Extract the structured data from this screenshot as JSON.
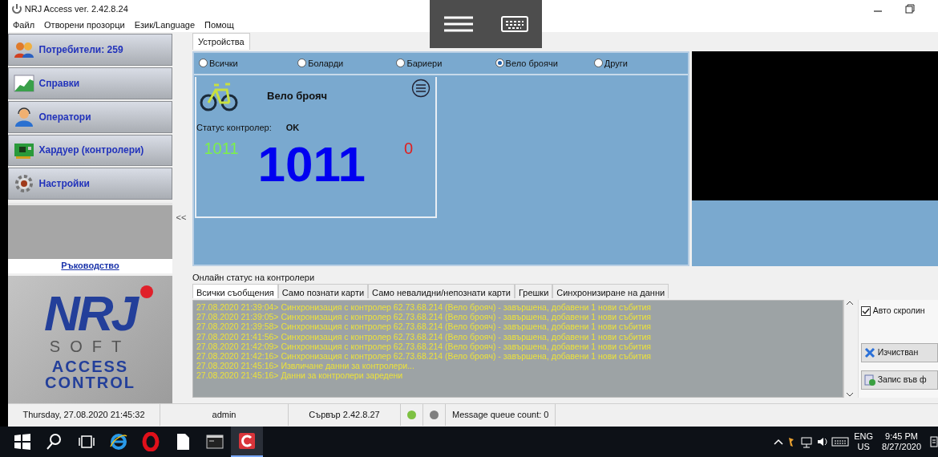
{
  "window": {
    "title": "NRJ Access ver. 2.42.8.24"
  },
  "menu": [
    "Файл",
    "Отворени прозорци",
    "Език/Language",
    "Помощ"
  ],
  "sidebar": {
    "items": [
      {
        "label": "Потребители: 259",
        "kind": "users"
      },
      {
        "label": "Справки",
        "kind": "chart"
      },
      {
        "label": "Оператори",
        "kind": "operator"
      },
      {
        "label": "Хардуер (контролери)",
        "kind": "board"
      },
      {
        "label": "Настройки",
        "kind": "gear"
      }
    ],
    "collapse": "<<",
    "manual_link": "Ръководство",
    "logo": {
      "mark": "NRJ",
      "sub": "SOFT",
      "line1": "ACCESS",
      "line2": "CONTROL"
    }
  },
  "tabs": [
    {
      "label": "Устройства",
      "selected": true
    }
  ],
  "device_filters": [
    {
      "label": "Всички",
      "selected": false
    },
    {
      "label": "Боларди",
      "selected": false
    },
    {
      "label": "Бариери",
      "selected": false
    },
    {
      "label": "Вело броячи",
      "selected": true
    },
    {
      "label": "Други",
      "selected": false
    }
  ],
  "device_card": {
    "title": "Вело брояч",
    "status_label": "Статус контролер:",
    "status_value": "OK",
    "count_in": "1011",
    "count_total": "1011",
    "count_out": "0"
  },
  "log": {
    "title": "Онлайн статус на контролери",
    "tabs": [
      {
        "label": "Всички съобщения",
        "selected": true
      },
      {
        "label": "Само познати карти",
        "selected": false
      },
      {
        "label": "Само невалидни/непознати карти",
        "selected": false
      },
      {
        "label": "Грешки",
        "selected": false
      },
      {
        "label": "Синхронизиране на данни",
        "selected": false
      }
    ],
    "lines": [
      "27.08.2020 21:39:04> Синхронизация с контролер 62.73.68.214 (Вело брояч) - завършена, добавени 1 нови събития",
      "27.08.2020 21:39:05> Синхронизация с контролер 62.73.68.214 (Вело брояч) - завършена, добавени 1 нови събития",
      "27.08.2020 21:39:58> Синхронизация с контролер 62.73.68.214 (Вело брояч) - завършена, добавени 1 нови събития",
      "27.08.2020 21:41:56> Синхронизация с контролер 62.73.68.214 (Вело брояч) - завършена, добавени 1 нови събития",
      "27.08.2020 21:42:09> Синхронизация с контролер 62.73.68.214 (Вело брояч) - завършена, добавени 1 нови събития",
      "27.08.2020 21:42:16> Синхронизация с контролер 62.73.68.214 (Вело брояч) - завършена, добавени 1 нови събития",
      "27.08.2020 21:45:16> Извличане данни за контролери...",
      "27.08.2020 21:45:16> Данни за контролери заредени"
    ]
  },
  "log_options": {
    "auto_scroll": {
      "label": "Авто скролин",
      "checked": true
    },
    "buttons": [
      {
        "label": "Изчистван",
        "kind": "clear"
      },
      {
        "label": "Запис във ф",
        "kind": "save"
      }
    ]
  },
  "status_bar": {
    "datetime": "Thursday, 27.08.2020 21:45:32",
    "user": "admin",
    "server": "Сървър 2.42.8.27",
    "indicators": [
      {
        "color": "#7dc142"
      },
      {
        "color": "#7f7f7f"
      }
    ],
    "queue": "Message queue count: 0"
  },
  "taskbar": {
    "apps": [
      {
        "kind": "start",
        "selected": false
      },
      {
        "kind": "search",
        "selected": false
      },
      {
        "kind": "taskview",
        "selected": false
      },
      {
        "kind": "browser",
        "selected": false
      },
      {
        "kind": "opera",
        "selected": false
      },
      {
        "kind": "file",
        "selected": false
      },
      {
        "kind": "terminal",
        "selected": false
      },
      {
        "kind": "app",
        "selected": true
      }
    ],
    "language": "ENG",
    "region": "US",
    "time": "9:45 PM",
    "date": "8/27/2020"
  }
}
